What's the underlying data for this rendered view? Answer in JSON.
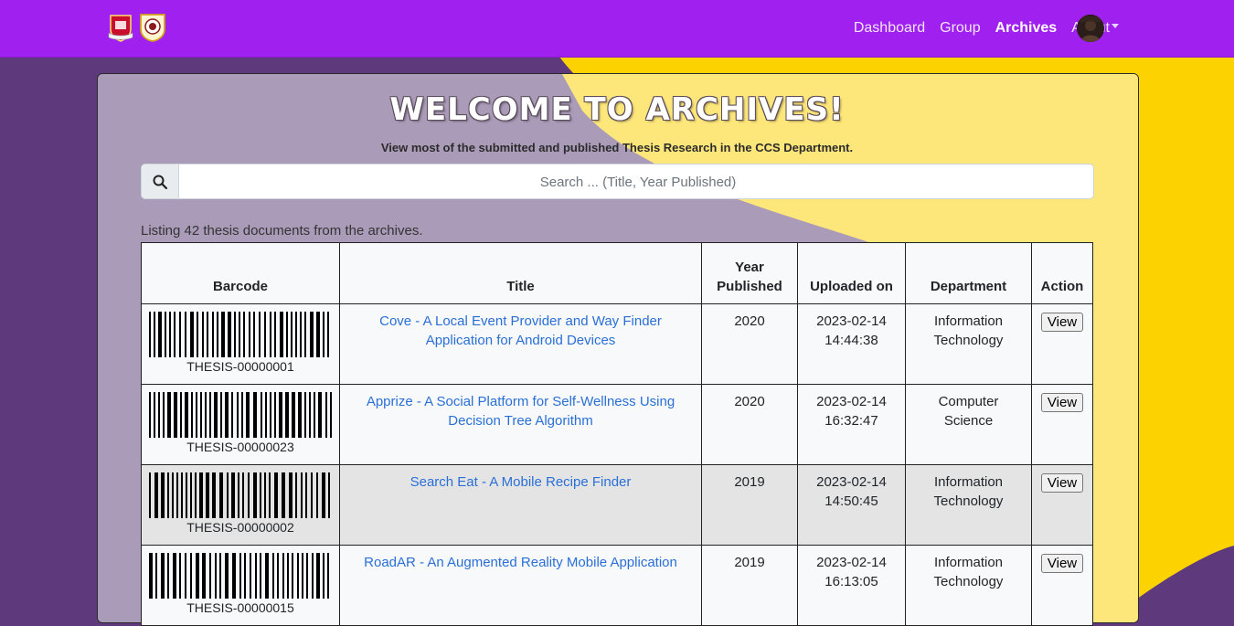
{
  "nav": {
    "links": [
      {
        "label": "Dashboard"
      },
      {
        "label": "Group"
      },
      {
        "label": "Archives"
      },
      {
        "label": "About"
      }
    ],
    "active": "Archives"
  },
  "page": {
    "title": "Welcome to Archives!",
    "subtitle": "View most of the submitted and published Thesis Research in the CCS Department.",
    "search_placeholder": "Search ... (Title, Year Published)",
    "listing": "Listing 42 thesis documents from the archives."
  },
  "table": {
    "headers": {
      "barcode": "Barcode",
      "title": "Title",
      "year_line1": "Year",
      "year_line2": "Published",
      "uploaded": "Uploaded on",
      "department": "Department",
      "action": "Action"
    },
    "rows": [
      {
        "barcode": "THESIS-00000001",
        "title": "Cove - A Local Event Provider and Way Finder Application for Android Devices",
        "year": "2020",
        "date": "2023-02-14",
        "time": "14:44:38",
        "dept_line1": "Information",
        "dept_line2": "Technology",
        "action": "View"
      },
      {
        "barcode": "THESIS-00000023",
        "title": "Apprize - A Social Platform for Self-Wellness Using Decision Tree Algorithm",
        "year": "2020",
        "date": "2023-02-14",
        "time": "16:32:47",
        "dept_line1": "Computer",
        "dept_line2": "Science",
        "action": "View"
      },
      {
        "barcode": "THESIS-00000002",
        "title": "Search Eat - A Mobile Recipe Finder",
        "year": "2019",
        "date": "2023-02-14",
        "time": "14:50:45",
        "dept_line1": "Information",
        "dept_line2": "Technology",
        "action": "View"
      },
      {
        "barcode": "THESIS-00000015",
        "title": "RoadAR - An Augmented Reality Mobile Application",
        "year": "2019",
        "date": "2023-02-14",
        "time": "16:13:05",
        "dept_line1": "Information",
        "dept_line2": "Technology",
        "action": "View"
      }
    ]
  },
  "colors": {
    "navbar": "#a020f0",
    "link": "#2a6fd6",
    "purple_bg": "#5e3a7c",
    "yellow_bg": "#fcd200",
    "card_purple": "#aa9cb9",
    "card_yellow": "#fde67a"
  },
  "icons": {
    "search": "magnifier-icon",
    "logo_left": "university-seal-icon",
    "logo_right": "college-seal-icon",
    "caret": "caret-down-icon"
  }
}
